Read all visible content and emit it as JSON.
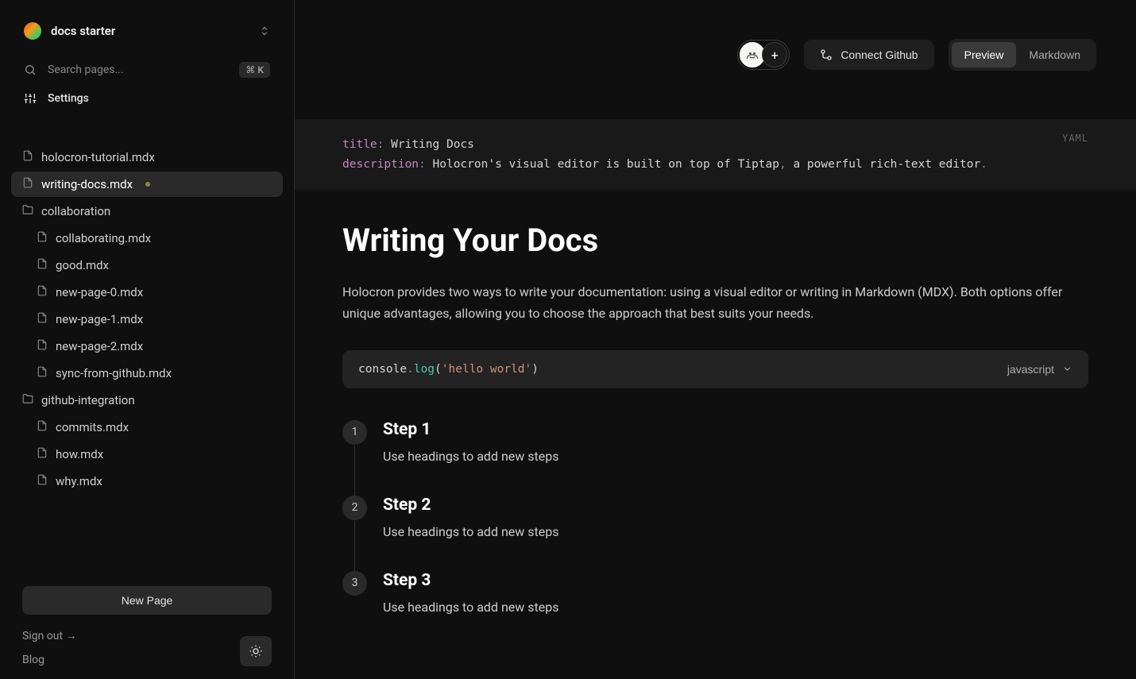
{
  "workspace": {
    "name": "docs starter"
  },
  "sidebar": {
    "search_placeholder": "Search pages...",
    "search_shortcut": "⌘ K",
    "settings_label": "Settings",
    "new_page_label": "New Page",
    "sign_out_label": "Sign out →",
    "blog_label": "Blog"
  },
  "tree": [
    {
      "type": "file",
      "label": "holocron-tutorial.mdx",
      "indent": 0,
      "active": false,
      "modified": false
    },
    {
      "type": "file",
      "label": "writing-docs.mdx",
      "indent": 0,
      "active": true,
      "modified": true
    },
    {
      "type": "folder",
      "label": "collaboration",
      "indent": 0,
      "active": false
    },
    {
      "type": "file",
      "label": "collaborating.mdx",
      "indent": 1,
      "active": false
    },
    {
      "type": "file",
      "label": "good.mdx",
      "indent": 1,
      "active": false
    },
    {
      "type": "file",
      "label": "new-page-0.mdx",
      "indent": 1,
      "active": false
    },
    {
      "type": "file",
      "label": "new-page-1.mdx",
      "indent": 1,
      "active": false
    },
    {
      "type": "file",
      "label": "new-page-2.mdx",
      "indent": 1,
      "active": false
    },
    {
      "type": "file",
      "label": "sync-from-github.mdx",
      "indent": 1,
      "active": false
    },
    {
      "type": "folder",
      "label": "github-integration",
      "indent": 0,
      "active": false
    },
    {
      "type": "file",
      "label": "commits.mdx",
      "indent": 1,
      "active": false
    },
    {
      "type": "file",
      "label": "how.mdx",
      "indent": 1,
      "active": false
    },
    {
      "type": "file",
      "label": "why.mdx",
      "indent": 1,
      "active": false
    }
  ],
  "toolbar": {
    "connect_label": "Connect Github",
    "preview_label": "Preview",
    "markdown_label": "Markdown",
    "add_collaborator": "+"
  },
  "frontmatter": {
    "badge": "YAML",
    "title_key": "title",
    "title_val": "Writing Docs",
    "desc_key": "description",
    "desc_val_1": "Holocron's visual editor is built on top of Tiptap",
    "desc_val_2": "a powerful rich-text editor"
  },
  "page": {
    "heading": "Writing Your Docs",
    "intro": "Holocron provides two ways to write your documentation: using a visual editor or writing in Markdown (MDX). Both options offer unique advantages, allowing you to choose the approach that best suits your needs."
  },
  "code": {
    "obj": "console",
    "method": "log",
    "str": "'hello world'",
    "lang": "javascript"
  },
  "steps": [
    {
      "num": "1",
      "title": "Step 1",
      "desc": "Use headings to add new steps"
    },
    {
      "num": "2",
      "title": "Step 2",
      "desc": "Use headings to add new steps"
    },
    {
      "num": "3",
      "title": "Step 3",
      "desc": "Use headings to add new steps"
    }
  ]
}
